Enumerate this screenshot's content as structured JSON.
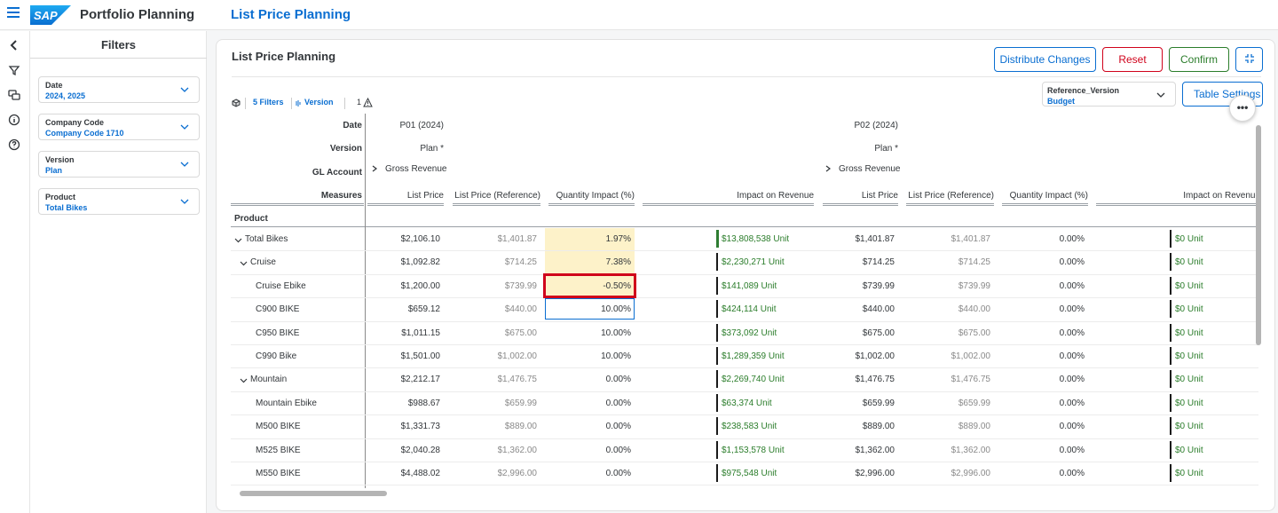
{
  "shell": {
    "app_name": "Portfolio Planning",
    "page_name": "List Price Planning"
  },
  "filters": {
    "title": "Filters",
    "items": [
      {
        "label": "Date",
        "value": "2024, 2025"
      },
      {
        "label": "Company Code",
        "value": "Company Code 1710"
      },
      {
        "label": "Version",
        "value": "Plan"
      },
      {
        "label": "Product",
        "value": "Total Bikes"
      }
    ]
  },
  "card": {
    "title": "List Price Planning",
    "buttons": {
      "distribute": "Distribute Changes",
      "reset": "Reset",
      "confirm": "Confirm",
      "table_settings": "Table Settings"
    },
    "reference": {
      "label": "Reference_Version",
      "value": "Budget"
    },
    "toolbar": {
      "filters": "5 Filters",
      "version": "Version",
      "warnings": "1"
    }
  },
  "grid": {
    "dim_labels": {
      "date": "Date",
      "version": "Version",
      "gl": "GL Account",
      "measures": "Measures",
      "product": "Product"
    },
    "periods": [
      {
        "date": "P01 (2024)",
        "version": "Plan *",
        "gl": "Gross Revenue"
      },
      {
        "date": "P02 (2024)",
        "version": "Plan *",
        "gl": "Gross Revenue"
      }
    ],
    "measures": [
      "List Price",
      "List Price (Reference)",
      "Quantity Impact (%)",
      "Impact on Revenue",
      "List Price",
      "List Price (Reference)",
      "Quantity Impact (%)",
      "Impact on Revenue"
    ],
    "rows": [
      {
        "name": "Total Bikes",
        "level": 0,
        "expanded": true,
        "v": [
          "$2,106.10",
          "$1,401.87",
          "1.97%",
          "$13,808,538 Unit",
          "$1,401.87",
          "$1,401.87",
          "0.00%",
          "$0 Unit"
        ]
      },
      {
        "name": "Cruise",
        "level": 1,
        "expanded": true,
        "v": [
          "$1,092.82",
          "$714.25",
          "7.38%",
          "$2,230,271 Unit",
          "$714.25",
          "$714.25",
          "0.00%",
          "$0 Unit"
        ]
      },
      {
        "name": "Cruise Ebike",
        "level": 2,
        "v": [
          "$1,200.00",
          "$739.99",
          "-0.50%",
          "$141,089 Unit",
          "$739.99",
          "$739.99",
          "0.00%",
          "$0 Unit"
        ]
      },
      {
        "name": "C900 BIKE",
        "level": 2,
        "v": [
          "$659.12",
          "$440.00",
          "10.00%",
          "$424,114 Unit",
          "$440.00",
          "$440.00",
          "0.00%",
          "$0 Unit"
        ]
      },
      {
        "name": "C950 BIKE",
        "level": 2,
        "v": [
          "$1,011.15",
          "$675.00",
          "10.00%",
          "$373,092 Unit",
          "$675.00",
          "$675.00",
          "0.00%",
          "$0 Unit"
        ]
      },
      {
        "name": "C990 Bike",
        "level": 2,
        "v": [
          "$1,501.00",
          "$1,002.00",
          "10.00%",
          "$1,289,359 Unit",
          "$1,002.00",
          "$1,002.00",
          "0.00%",
          "$0 Unit"
        ]
      },
      {
        "name": "Mountain",
        "level": 1,
        "expanded": true,
        "v": [
          "$2,212.17",
          "$1,476.75",
          "0.00%",
          "$2,269,740 Unit",
          "$1,476.75",
          "$1,476.75",
          "0.00%",
          "$0 Unit"
        ]
      },
      {
        "name": "Mountain Ebike",
        "level": 2,
        "v": [
          "$988.67",
          "$659.99",
          "0.00%",
          "$63,374 Unit",
          "$659.99",
          "$659.99",
          "0.00%",
          "$0 Unit"
        ]
      },
      {
        "name": "M500 BIKE",
        "level": 2,
        "v": [
          "$1,331.73",
          "$889.00",
          "0.00%",
          "$238,583 Unit",
          "$889.00",
          "$889.00",
          "0.00%",
          "$0 Unit"
        ]
      },
      {
        "name": "M525 BIKE",
        "level": 2,
        "v": [
          "$2,040.28",
          "$1,362.00",
          "0.00%",
          "$1,153,578 Unit",
          "$1,362.00",
          "$1,362.00",
          "0.00%",
          "$0 Unit"
        ]
      },
      {
        "name": "M550 BIKE",
        "level": 2,
        "v": [
          "$4,488.02",
          "$2,996.00",
          "0.00%",
          "$975,548 Unit",
          "$2,996.00",
          "$2,996.00",
          "0.00%",
          "$0 Unit"
        ]
      }
    ]
  },
  "colors": {
    "accent": "#0a6ed1",
    "reset": "#d0021b",
    "confirm": "#2b7d2b",
    "highlight": "#fdf2c9",
    "selection": "#d0021b"
  }
}
